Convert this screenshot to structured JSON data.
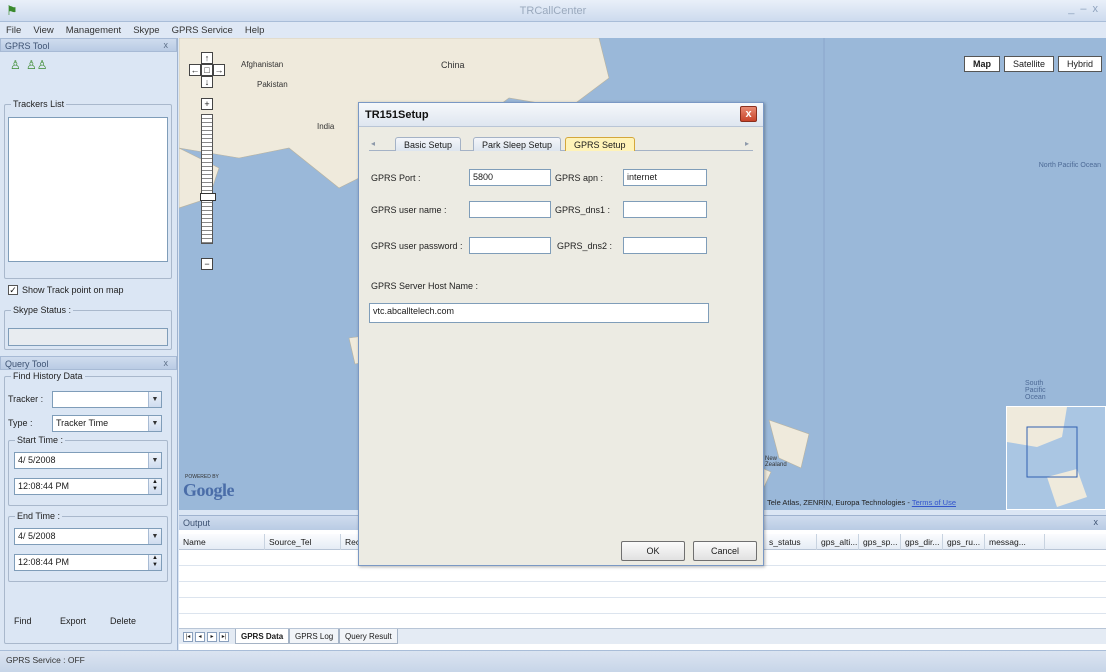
{
  "window": {
    "title": "TRCallCenter",
    "controls": [
      "_",
      "–",
      "x"
    ]
  },
  "menu": [
    "File",
    "View",
    "Management",
    "Skype",
    "GPRS Service",
    "Help"
  ],
  "gprs_tool": {
    "title": "GPRS Tool",
    "close": "x",
    "trackers_list_label": "Trackers List",
    "show_track_label": "Show Track point on map",
    "show_track_checked": true,
    "skype_status_label": "Skype Status :"
  },
  "query_tool": {
    "title": "Query Tool",
    "close": "x",
    "find_history_label": "Find History Data",
    "tracker_label": "Tracker :",
    "tracker_value": "",
    "type_label": "Type :",
    "type_value": "Tracker Time",
    "start_time_label": "Start Time :",
    "start_date": "4/ 5/2008",
    "start_time": "12:08:44 PM",
    "end_time_label": "End Time :",
    "end_date": "4/ 5/2008",
    "end_time": "12:08:44 PM",
    "find_label": "Find",
    "export_label": "Export",
    "delete_label": "Delete"
  },
  "map": {
    "type_buttons": [
      "Map",
      "Satellite",
      "Hybrid"
    ],
    "selected_type": "Map",
    "labels": [
      "Afghanistan",
      "Pakistan",
      "China",
      "India",
      "North Pacific Ocean",
      "South Pacific Ocean",
      "New Zealand"
    ],
    "copyright": "Tele Atlas, ZENRIN, Europa Technologies -",
    "terms": "Terms of Use",
    "powered_by": "POWERED BY",
    "google_logo": "Google"
  },
  "dialog": {
    "title": "TR151Setup",
    "close": "x",
    "tabs": [
      "Basic Setup",
      "Park Sleep Setup",
      "GPRS Setup"
    ],
    "selected_tab": "GPRS Setup",
    "gprs_port_label": "GPRS Port :",
    "gprs_port_value": "5800",
    "gprs_apn_label": "GPRS apn :",
    "gprs_apn_value": "internet",
    "gprs_user_label": "GPRS user name :",
    "gprs_user_value": "",
    "gprs_dns1_label": "GPRS_dns1 :",
    "gprs_dns1_value": "",
    "gprs_pwd_label": "GPRS user password :",
    "gprs_pwd_value": "",
    "gprs_dns2_label": "GPRS_dns2 :",
    "gprs_dns2_value": "",
    "host_label": "GPRS Server Host Name :",
    "host_value": "vtc.abcalltelech.com",
    "ok_label": "OK",
    "cancel_label": "Cancel"
  },
  "output": {
    "title": "Output",
    "close": "x",
    "columns": [
      "Name",
      "Source_Tel",
      "Rec",
      "s_status",
      "gps_alti...",
      "gps_sp...",
      "gps_dir...",
      "gps_ru...",
      "messag..."
    ],
    "sheet_tabs": [
      "GPRS Data",
      "GPRS Log",
      "Query Result"
    ],
    "selected_sheet": "GPRS Data"
  },
  "status": {
    "text": "GPRS Service : OFF"
  }
}
